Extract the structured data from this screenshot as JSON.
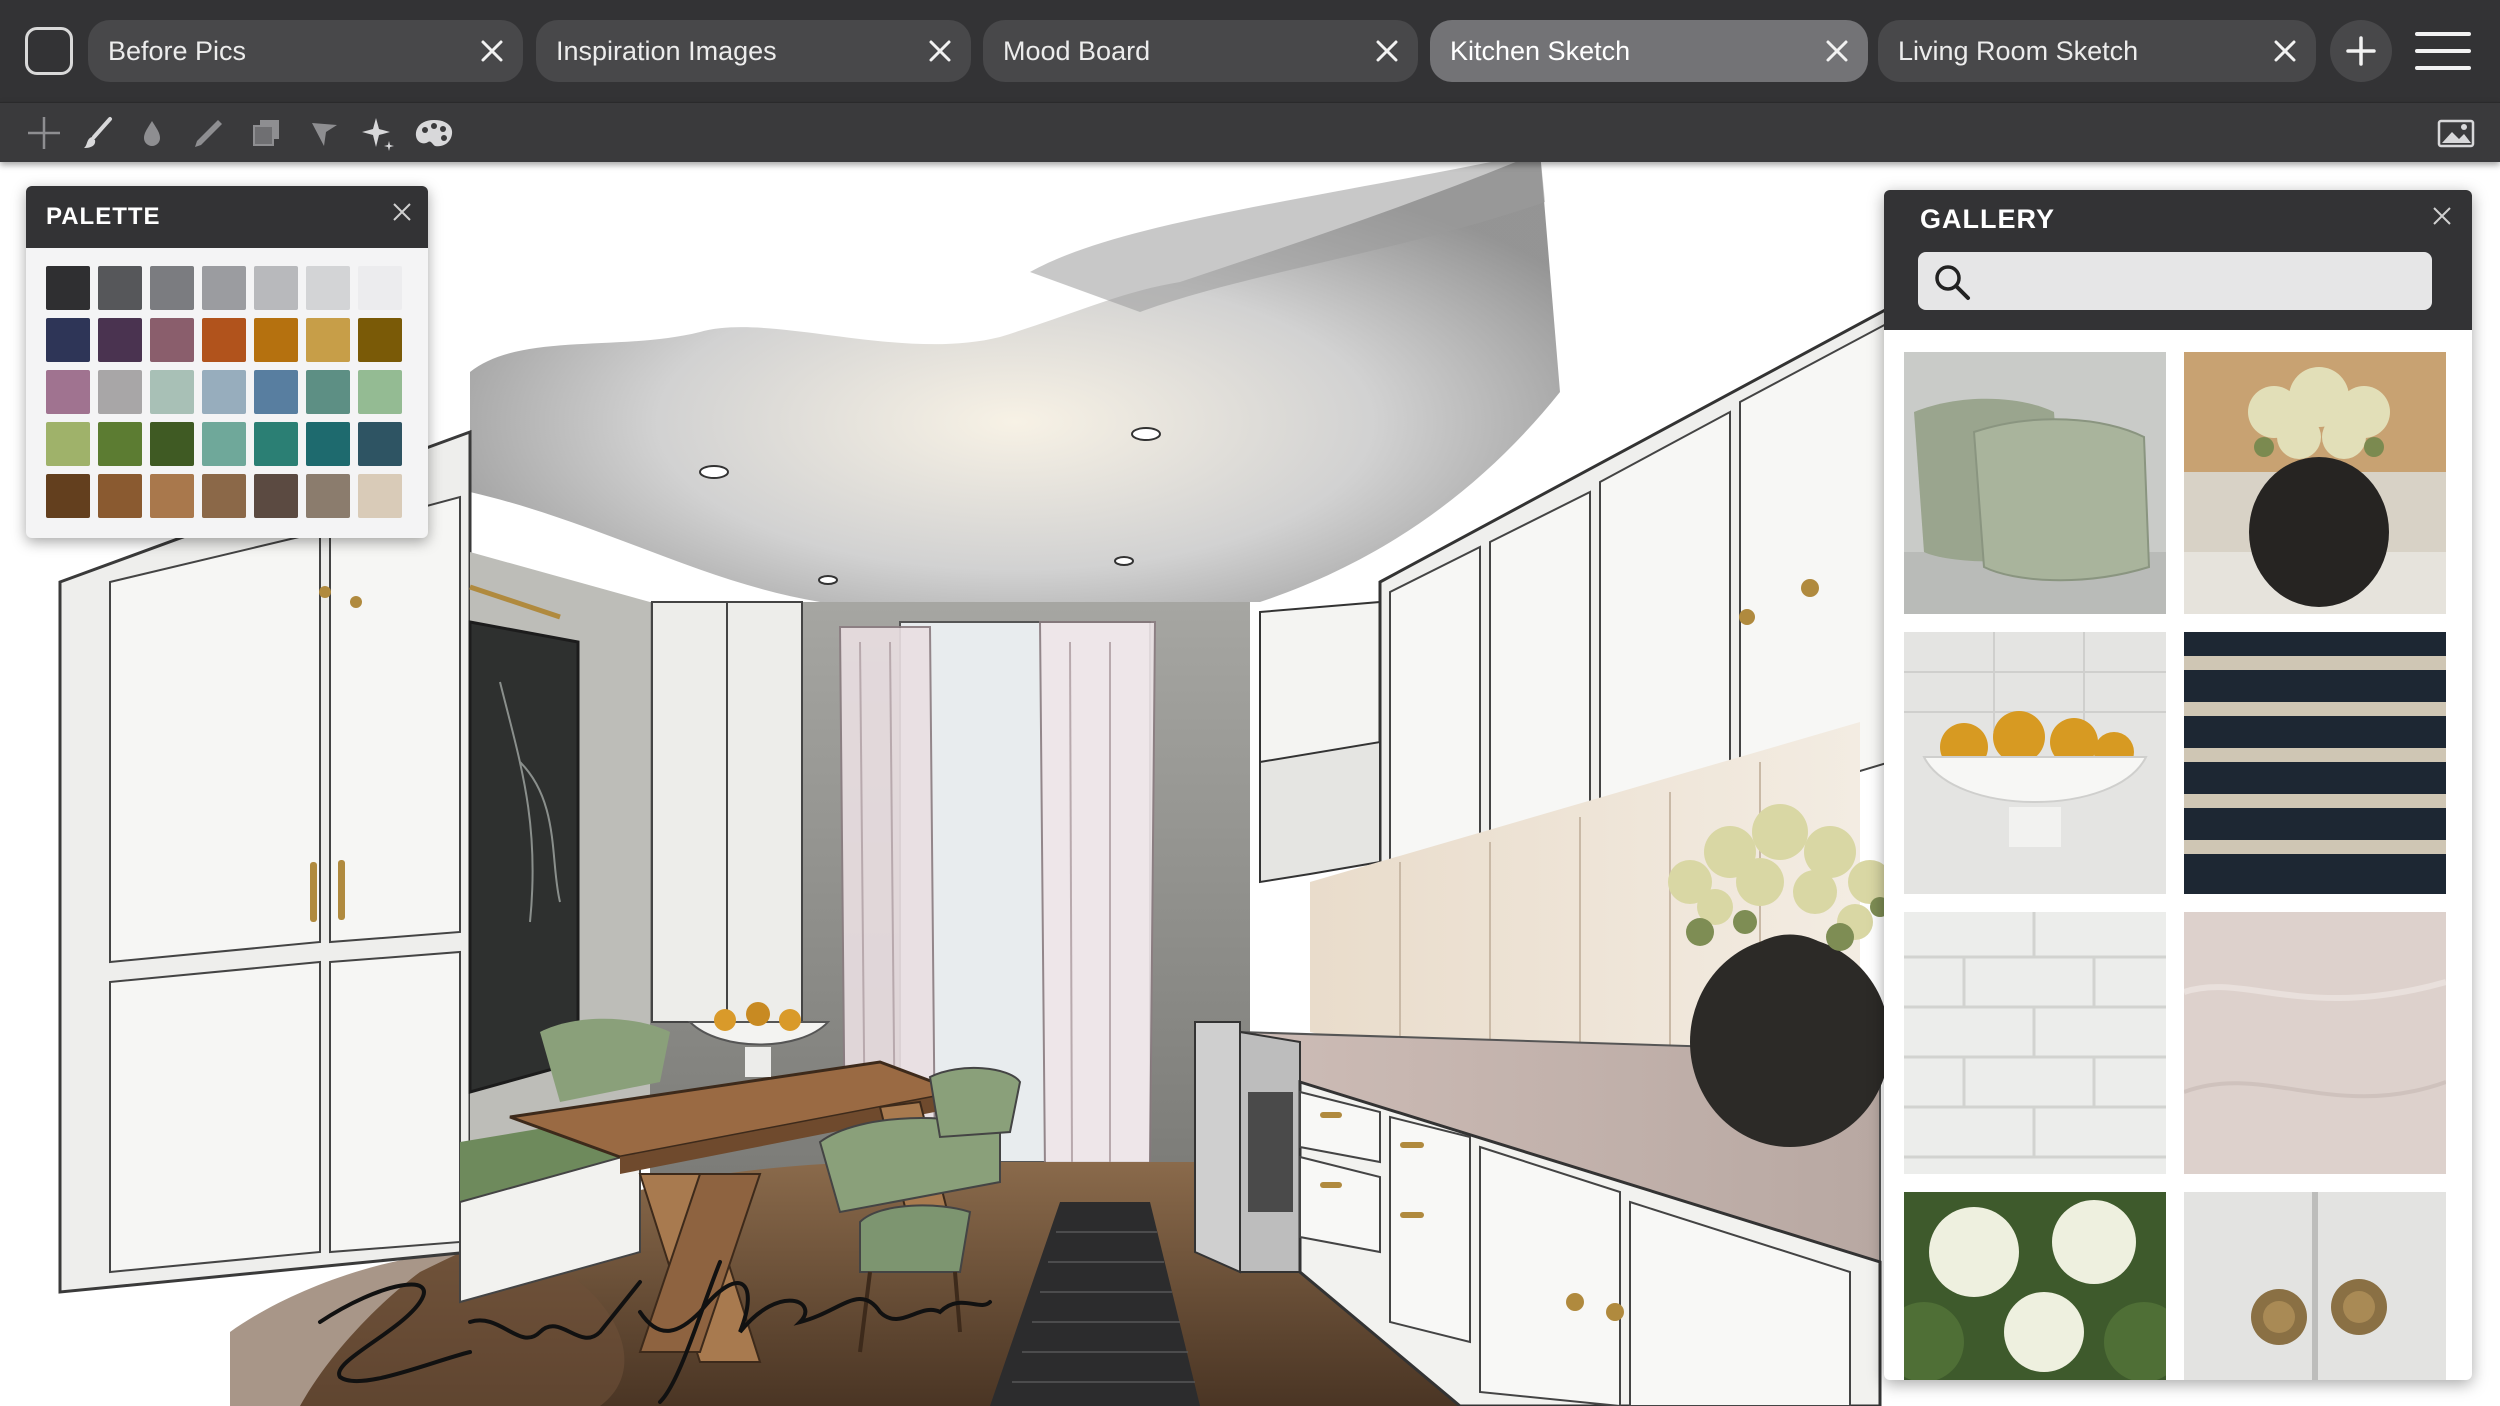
{
  "tabs": [
    {
      "label": "Before Pics",
      "active": false
    },
    {
      "label": "Inspiration Images",
      "active": false
    },
    {
      "label": "Mood Board",
      "active": false
    },
    {
      "label": "Kitchen Sketch",
      "active": true
    },
    {
      "label": "Living Room Sketch",
      "active": false
    }
  ],
  "toolbar": {
    "tools": [
      "transform-icon",
      "brush-icon",
      "fill-drop-icon",
      "pencil-icon",
      "layers-icon",
      "selection-icon",
      "magic-sparkle-icon",
      "palette-icon"
    ],
    "right_tool": "image-icon"
  },
  "palette": {
    "title": "PALETTE",
    "swatches": [
      "#2f2f31",
      "#56575a",
      "#7b7c80",
      "#9b9ca0",
      "#b8b9bc",
      "#d3d4d6",
      "#ececee",
      "#2e3557",
      "#4a3350",
      "#8a5e6c",
      "#b1531c",
      "#b5710f",
      "#c79e48",
      "#7a5a07",
      "#a07390",
      "#a8a6a7",
      "#a8c0b6",
      "#97adbd",
      "#587ea0",
      "#5d8f84",
      "#94bb93",
      "#9fb26a",
      "#5c7c32",
      "#3f5a23",
      "#6fa89a",
      "#2b7f74",
      "#1e6a6e",
      "#2e5463",
      "#633f1e",
      "#8a5a30",
      "#a9784c",
      "#8b6848",
      "#5b4a41",
      "#8b7c6d",
      "#d9cbb8"
    ]
  },
  "gallery": {
    "title": "GALLERY",
    "search_placeholder": "",
    "thumbnails": [
      "green-pillows-image",
      "vase-flowers-image",
      "pear-bowl-image",
      "striped-rug-image",
      "white-tile-image",
      "marble-texture-image",
      "hydrangea-image",
      "brass-knobs-image"
    ]
  },
  "canvas": {
    "subject": "kitchen-sketch-image"
  },
  "colors": {
    "tabbar_bg": "#333335",
    "tab_bg": "#48484a",
    "tab_active_bg": "#737376",
    "toolbar_bg": "#3a3a3c"
  }
}
